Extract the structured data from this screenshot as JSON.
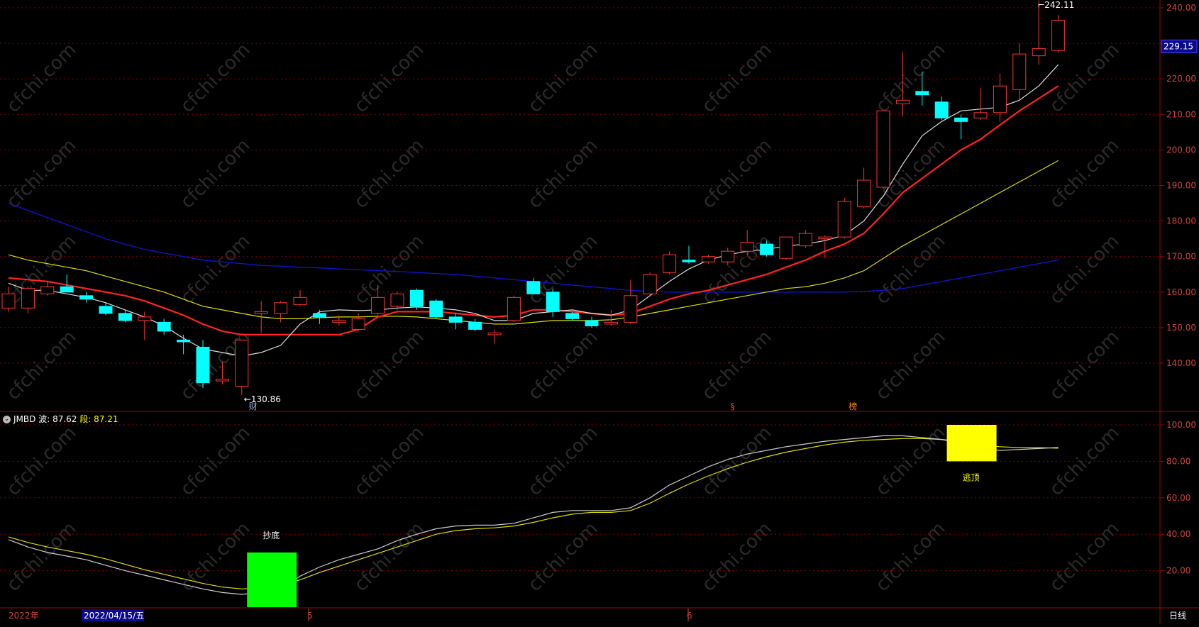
{
  "indicator": {
    "name": "JMBD",
    "wave_label": "波:",
    "wave_value": "87.62",
    "segment_label": "段:",
    "segment_value": "87.21"
  },
  "markers": {
    "low_label": "←130.86",
    "high_label": "242.11",
    "current_price": "229.15",
    "caifu_mark": "财",
    "dollar_mark": "§",
    "bang_mark": "榜",
    "bottom_signal": "抄底",
    "top_signal": "逃顶"
  },
  "x_axis": {
    "year_label": "2022年",
    "cursor_date": "2022/04/15/五",
    "month_5": "5",
    "month_6": "6",
    "period_label": "日线"
  },
  "colors": {
    "background": "#000000",
    "up_candle": "#ff3333",
    "down_candle": "#00ffff",
    "ma_white": "#dddddd",
    "ma_red": "#ff2222",
    "ma_yellow": "#dddd00",
    "ma_blue": "#1111cc",
    "grid": "#8b0000",
    "bottom_block": "#00ff00",
    "top_block": "#ffff00"
  },
  "chart_data": [
    {
      "type": "candlestick",
      "y_ticks": [
        140,
        150,
        160,
        170,
        180,
        190,
        200,
        210,
        220,
        230,
        240
      ],
      "ylim": [
        128,
        243
      ],
      "candles": [
        {
          "o": 155.5,
          "h": 161.5,
          "l": 154.5,
          "c": 159.5
        },
        {
          "o": 155.5,
          "h": 161.5,
          "l": 154.0,
          "c": 161.0
        },
        {
          "o": 159.5,
          "h": 163.0,
          "l": 159.0,
          "c": 161.5
        },
        {
          "o": 161.5,
          "h": 165.0,
          "l": 160.5,
          "c": 160.0
        },
        {
          "o": 159.0,
          "h": 160.0,
          "l": 157.0,
          "c": 158.0
        },
        {
          "o": 156.0,
          "h": 157.0,
          "l": 153.5,
          "c": 154.0
        },
        {
          "o": 154.0,
          "h": 155.0,
          "l": 151.5,
          "c": 152.0
        },
        {
          "o": 152.0,
          "h": 154.5,
          "l": 146.5,
          "c": 153.0
        },
        {
          "o": 151.5,
          "h": 152.5,
          "l": 148.0,
          "c": 149.0
        },
        {
          "o": 146.5,
          "h": 148.0,
          "l": 142.5,
          "c": 146.0
        },
        {
          "o": 144.5,
          "h": 146.5,
          "l": 133.0,
          "c": 134.5
        },
        {
          "o": 135.0,
          "h": 140.5,
          "l": 134.0,
          "c": 135.5
        },
        {
          "o": 133.5,
          "h": 146.5,
          "l": 131.0,
          "c": 146.5
        },
        {
          "o": 154.0,
          "h": 157.5,
          "l": 148.5,
          "c": 154.5
        },
        {
          "o": 154.0,
          "h": 157.5,
          "l": 151.5,
          "c": 157.0
        },
        {
          "o": 156.5,
          "h": 160.5,
          "l": 156.0,
          "c": 158.5
        },
        {
          "o": 154.0,
          "h": 155.0,
          "l": 151.0,
          "c": 153.0
        },
        {
          "o": 151.5,
          "h": 153.5,
          "l": 150.5,
          "c": 152.0
        },
        {
          "o": 149.5,
          "h": 154.0,
          "l": 149.0,
          "c": 152.5
        },
        {
          "o": 154.0,
          "h": 162.0,
          "l": 153.5,
          "c": 158.5
        },
        {
          "o": 156.0,
          "h": 160.0,
          "l": 155.0,
          "c": 159.5
        },
        {
          "o": 160.5,
          "h": 161.0,
          "l": 155.0,
          "c": 156.0
        },
        {
          "o": 157.5,
          "h": 158.0,
          "l": 152.5,
          "c": 153.0
        },
        {
          "o": 153.0,
          "h": 154.0,
          "l": 149.5,
          "c": 151.5
        },
        {
          "o": 151.5,
          "h": 152.5,
          "l": 149.0,
          "c": 149.5
        },
        {
          "o": 148.0,
          "h": 149.5,
          "l": 145.5,
          "c": 148.5
        },
        {
          "o": 152.0,
          "h": 159.0,
          "l": 151.5,
          "c": 158.5
        },
        {
          "o": 163.0,
          "h": 164.0,
          "l": 159.5,
          "c": 159.5
        },
        {
          "o": 160.0,
          "h": 161.0,
          "l": 153.0,
          "c": 154.5
        },
        {
          "o": 154.0,
          "h": 154.5,
          "l": 152.0,
          "c": 152.5
        },
        {
          "o": 152.0,
          "h": 153.0,
          "l": 150.0,
          "c": 150.5
        },
        {
          "o": 151.0,
          "h": 155.0,
          "l": 150.5,
          "c": 151.5
        },
        {
          "o": 151.5,
          "h": 163.5,
          "l": 151.0,
          "c": 159.0
        },
        {
          "o": 159.5,
          "h": 165.5,
          "l": 159.0,
          "c": 165.0
        },
        {
          "o": 165.5,
          "h": 171.5,
          "l": 165.0,
          "c": 170.5
        },
        {
          "o": 169.0,
          "h": 173.0,
          "l": 168.0,
          "c": 168.5
        },
        {
          "o": 168.5,
          "h": 170.5,
          "l": 168.0,
          "c": 170.0
        },
        {
          "o": 168.5,
          "h": 172.5,
          "l": 167.5,
          "c": 171.5
        },
        {
          "o": 171.5,
          "h": 177.5,
          "l": 170.5,
          "c": 174.0
        },
        {
          "o": 173.5,
          "h": 174.5,
          "l": 170.0,
          "c": 170.5
        },
        {
          "o": 169.5,
          "h": 175.5,
          "l": 169.0,
          "c": 175.5
        },
        {
          "o": 173.0,
          "h": 177.5,
          "l": 172.5,
          "c": 176.5
        },
        {
          "o": 175.0,
          "h": 176.0,
          "l": 169.5,
          "c": 175.5
        },
        {
          "o": 175.5,
          "h": 186.5,
          "l": 175.0,
          "c": 185.5
        },
        {
          "o": 184.0,
          "h": 195.0,
          "l": 183.5,
          "c": 191.5
        },
        {
          "o": 189.5,
          "h": 211.0,
          "l": 189.0,
          "c": 211.0
        },
        {
          "o": 213.0,
          "h": 227.5,
          "l": 209.5,
          "c": 214.0
        },
        {
          "o": 216.5,
          "h": 222.0,
          "l": 212.5,
          "c": 215.5
        },
        {
          "o": 213.5,
          "h": 215.0,
          "l": 208.5,
          "c": 209.0
        },
        {
          "o": 209.0,
          "h": 210.0,
          "l": 203.0,
          "c": 208.0
        },
        {
          "o": 209.0,
          "h": 217.5,
          "l": 208.5,
          "c": 210.5
        },
        {
          "o": 210.5,
          "h": 221.5,
          "l": 208.0,
          "c": 218.0
        },
        {
          "o": 217.0,
          "h": 230.0,
          "l": 214.0,
          "c": 227.0
        },
        {
          "o": 226.5,
          "h": 242.1,
          "l": 224.0,
          "c": 228.5
        },
        {
          "o": 228.0,
          "h": 238.0,
          "l": 227.5,
          "c": 236.5
        }
      ],
      "ma_white": [
        162.5,
        160.5,
        160.5,
        159.5,
        158.5,
        157.0,
        155.0,
        153.0,
        150.5,
        147.0,
        144.0,
        143.0,
        142.0,
        143.0,
        145.0,
        151.0,
        154.5,
        155.0,
        154.8,
        155.0,
        155.5,
        155.8,
        155.5,
        155.0,
        154.0,
        152.0,
        152.0,
        154.0,
        154.5,
        155.0,
        154.0,
        153.5,
        155.0,
        159.0,
        163.0,
        166.5,
        169.0,
        170.5,
        171.5,
        172.0,
        173.0,
        173.5,
        174.5,
        176.0,
        180.0,
        187.0,
        196.0,
        204.0,
        208.0,
        211.0,
        211.5,
        212.0,
        214.0,
        218.0,
        224.0
      ],
      "ma_red": [
        164.0,
        163.5,
        163.0,
        162.0,
        161.0,
        160.0,
        159.0,
        157.5,
        155.5,
        153.5,
        151.0,
        149.0,
        148.0,
        148.0,
        148.0,
        148.0,
        148.0,
        148.0,
        149.5,
        153.0,
        154.5,
        154.5,
        154.5,
        154.0,
        153.5,
        153.0,
        153.5,
        155.0,
        155.0,
        154.5,
        154.0,
        153.5,
        154.0,
        156.0,
        158.0,
        159.5,
        160.5,
        162.0,
        163.5,
        165.0,
        167.0,
        169.0,
        171.5,
        173.5,
        176.5,
        182.0,
        188.0,
        192.0,
        196.0,
        200.0,
        203.0,
        207.0,
        211.0,
        214.5,
        218.0
      ],
      "ma_yellow": [
        170.5,
        169.0,
        168.0,
        167.0,
        166.0,
        164.5,
        163.0,
        161.5,
        160.0,
        158.0,
        156.0,
        155.0,
        154.0,
        153.0,
        152.5,
        152.5,
        152.8,
        153.0,
        153.0,
        153.2,
        153.2,
        153.0,
        152.5,
        152.0,
        151.5,
        151.0,
        151.0,
        151.5,
        152.0,
        152.0,
        152.0,
        152.2,
        153.0,
        154.0,
        155.0,
        156.0,
        157.0,
        158.0,
        159.0,
        160.0,
        161.0,
        161.5,
        162.5,
        164.0,
        166.0,
        169.5,
        173.0,
        176.0,
        179.0,
        182.0,
        185.0,
        188.0,
        191.0,
        194.0,
        197.0
      ],
      "ma_blue": [
        185.0,
        183.0,
        181.0,
        179.0,
        177.0,
        175.0,
        173.5,
        172.0,
        171.0,
        170.0,
        169.0,
        168.5,
        168.0,
        167.5,
        167.3,
        167.0,
        166.8,
        166.5,
        166.3,
        166.0,
        165.8,
        165.5,
        165.2,
        165.0,
        164.5,
        164.0,
        163.5,
        163.0,
        162.5,
        162.0,
        161.5,
        161.0,
        160.5,
        160.2,
        160.0,
        160.0,
        160.0,
        160.0,
        160.0,
        160.0,
        160.0,
        160.0,
        160.0,
        160.0,
        160.2,
        160.5,
        161.0,
        162.0,
        163.0,
        164.0,
        165.0,
        166.0,
        167.0,
        168.0,
        169.0
      ]
    },
    {
      "type": "line",
      "name": "JMBD",
      "y_ticks": [
        20,
        40,
        60,
        80,
        100
      ],
      "ylim": [
        0,
        104
      ],
      "series": [
        {
          "name": "波",
          "values": [
            37.0,
            33.0,
            30.0,
            28.0,
            26.0,
            23.0,
            20.0,
            17.5,
            15.0,
            12.5,
            10.0,
            8.0,
            7.0,
            8.0,
            10.0,
            17.0,
            22.0,
            26.0,
            29.0,
            32.0,
            36.5,
            40.0,
            43.0,
            44.5,
            45.0,
            45.0,
            46.0,
            49.0,
            52.0,
            53.0,
            53.0,
            53.0,
            54.5,
            60.0,
            67.0,
            72.0,
            77.0,
            81.0,
            84.0,
            86.0,
            88.0,
            89.5,
            91.0,
            92.0,
            93.0,
            94.0,
            94.0,
            93.0,
            92.0,
            90.0,
            87.0,
            86.0,
            86.5,
            87.0,
            87.62
          ]
        },
        {
          "name": "段",
          "values": [
            38.5,
            35.5,
            33.0,
            31.0,
            29.0,
            26.5,
            23.5,
            20.5,
            18.0,
            15.5,
            13.0,
            11.0,
            10.0,
            10.5,
            12.0,
            15.0,
            19.0,
            22.5,
            26.0,
            29.5,
            33.0,
            36.5,
            40.0,
            42.0,
            43.0,
            43.5,
            44.5,
            46.5,
            49.0,
            51.0,
            52.0,
            52.0,
            53.0,
            57.0,
            62.5,
            67.5,
            72.0,
            76.0,
            79.5,
            82.5,
            85.0,
            87.0,
            89.0,
            90.5,
            91.5,
            92.0,
            92.5,
            92.5,
            92.0,
            91.0,
            89.0,
            88.0,
            87.5,
            87.5,
            87.21
          ]
        }
      ],
      "signals": [
        {
          "label": "抄底",
          "index": 13,
          "from": 0,
          "to": 30
        },
        {
          "label": "逃顶",
          "index": 49,
          "from": 80,
          "to": 100
        }
      ]
    }
  ]
}
